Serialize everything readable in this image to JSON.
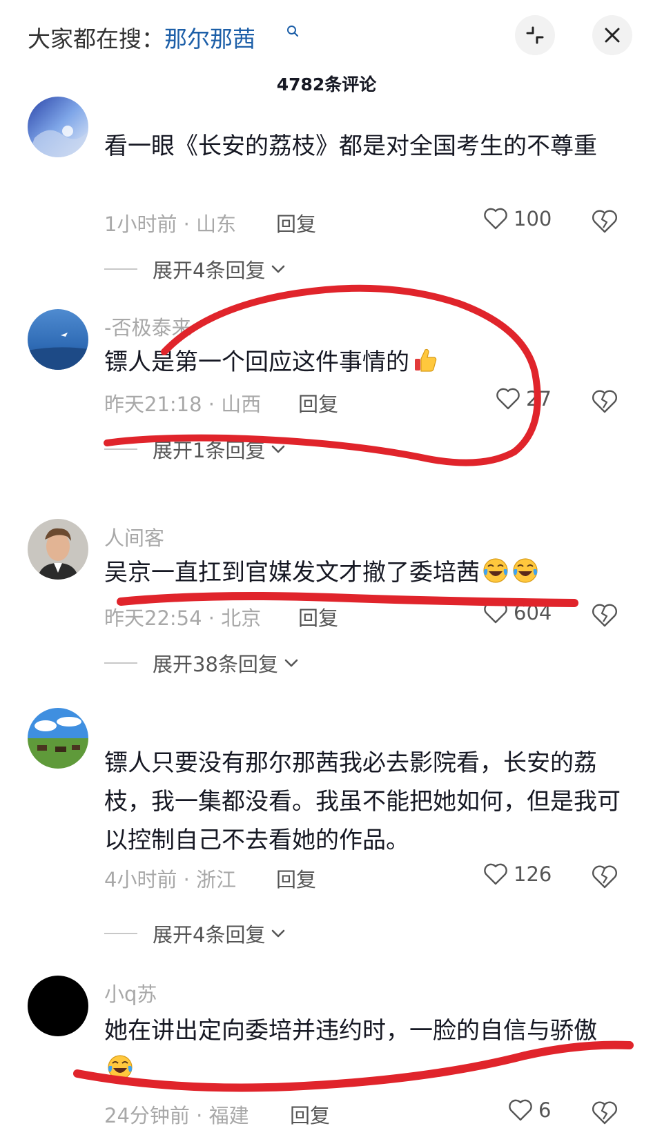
{
  "header": {
    "hot_prefix": "大家都在搜：",
    "hot_term": "那尔那茜",
    "comment_count": "4782条评论"
  },
  "comments": [
    {
      "username": "",
      "text": "看一眼《长安的荔枝》都是对全国考生的不尊重",
      "time": "1小时前",
      "location": "山东",
      "reply_label": "回复",
      "likes": "100",
      "expand_label": "展开4条回复"
    },
    {
      "username": "-否极泰来-",
      "text": "镖人是第一个回应这件事情的",
      "time": "昨天21:18",
      "location": "山西",
      "reply_label": "回复",
      "likes": "27",
      "expand_label": "展开1条回复"
    },
    {
      "username": "人间客",
      "text": "吴京一直扛到官媒发文才撤了委培茜",
      "time": "昨天22:54",
      "location": "北京",
      "reply_label": "回复",
      "likes": "604",
      "expand_label": "展开38条回复"
    },
    {
      "username": "",
      "text": "镖人只要没有那尔那茜我必去影院看，长安的荔枝，我一集都没看。我虽不能把她如何，但是我可以控制自己不去看她的作品。",
      "time": "4小时前",
      "location": "浙江",
      "reply_label": "回复",
      "likes": "126",
      "expand_label": "展开4条回复"
    },
    {
      "username": "小q苏",
      "text": "她在讲出定向委培并违约时，一脸的自信与骄傲",
      "time": "24分钟前",
      "location": "福建",
      "reply_label": "回复",
      "likes": "6",
      "expand_label": ""
    }
  ],
  "icons": {
    "hot_search": "search-icon",
    "collapse": "collapse-icon",
    "close": "close-icon",
    "like": "heart-outline-icon",
    "dislike": "broken-heart-icon",
    "thumbs_up_emoji": "thumbs-up-emoji",
    "laughing_crying_emoji": "laughing-crying-emoji"
  },
  "colors": {
    "hot_term": "#1d5fa8",
    "annotation_marker": "#e0242b",
    "meta_text": "#a8a8a8"
  }
}
